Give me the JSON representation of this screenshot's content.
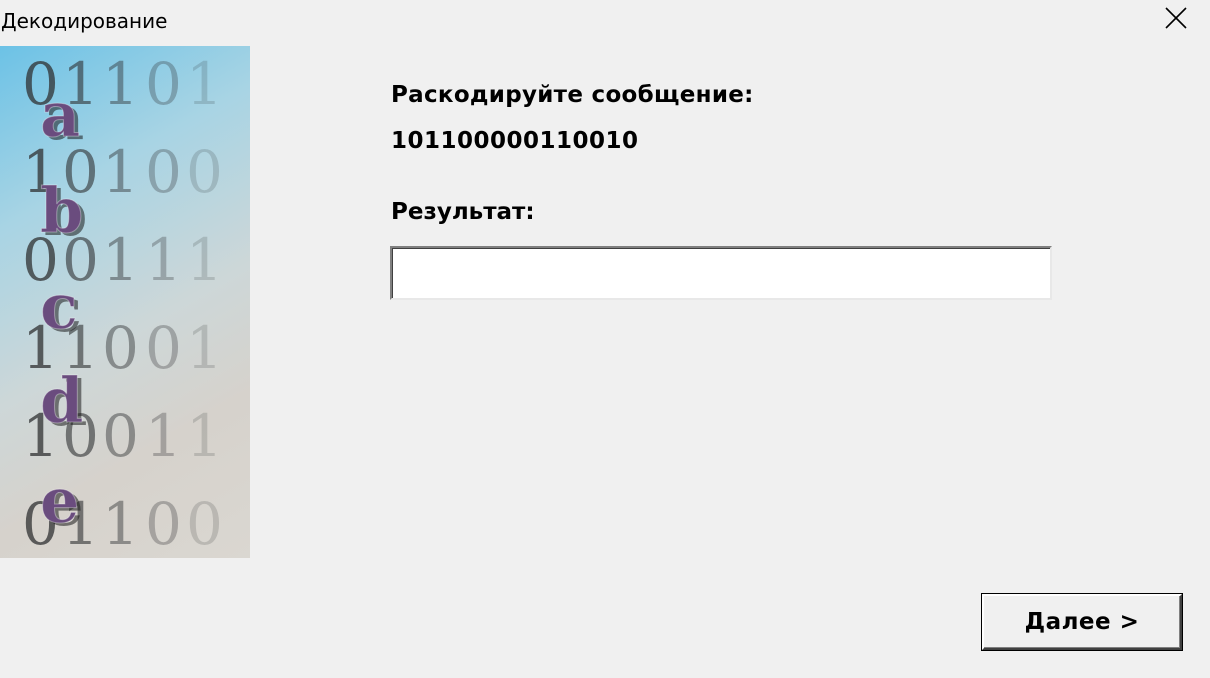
{
  "window": {
    "title": "Декодирование",
    "close_icon": "close-icon"
  },
  "banner": {
    "digit_rows": [
      "01101",
      "10100",
      "00111",
      "11001",
      "10011",
      "01100"
    ],
    "letters": [
      "a",
      "b",
      "c",
      "d",
      "e"
    ],
    "letter_color": "#6a4c7e"
  },
  "main": {
    "prompt": "Раскодируйте сообщение:",
    "code": "101100000110010",
    "result_label": "Результат:",
    "result_value": ""
  },
  "buttons": {
    "next_label": "Далее >"
  }
}
